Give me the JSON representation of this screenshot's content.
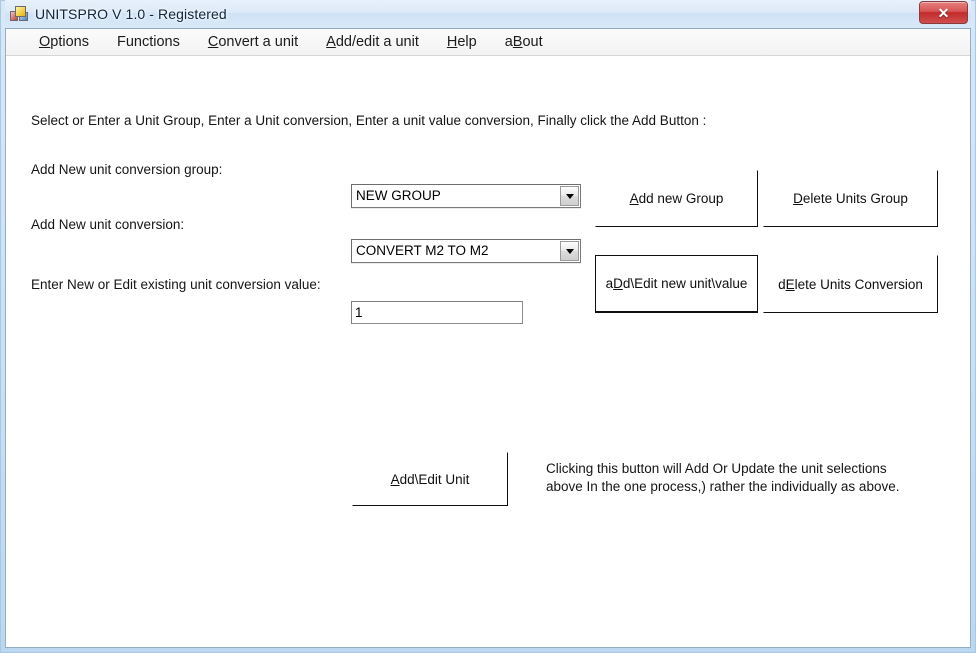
{
  "window": {
    "title": "UNITSPRO V 1.0 - Registered",
    "app_icon": "vb-form-icon",
    "close_label": "✕",
    "accent_color": "#c22a2a",
    "titlebar_color": "#dce9f8",
    "frame_color": "#bcd8f0"
  },
  "menubar": {
    "items": [
      {
        "pre": "",
        "acc": "O",
        "post": "ptions",
        "name": "menu-options"
      },
      {
        "pre": "Functions",
        "acc": "",
        "post": "",
        "name": "menu-functions"
      },
      {
        "pre": "",
        "acc": "C",
        "post": "onvert a unit",
        "name": "menu-convert-a-unit"
      },
      {
        "pre": "",
        "acc": "A",
        "post": "dd/edit a unit",
        "name": "menu-add-edit-a-unit"
      },
      {
        "pre": "",
        "acc": "H",
        "post": "elp",
        "name": "menu-help"
      },
      {
        "pre": "a",
        "acc": "B",
        "post": "out",
        "name": "menu-about"
      }
    ]
  },
  "main": {
    "instruction": "Select or Enter a Unit Group, Enter a Unit conversion, Enter a unit value conversion, Finally click the Add Button :",
    "labels": {
      "group": "Add New unit conversion group:",
      "conversion": "Add New unit conversion:",
      "value": "Enter New or Edit existing unit conversion value:"
    },
    "combo_group": {
      "value": "NEW GROUP",
      "options": [
        "NEW GROUP"
      ],
      "arrow_icon": "chevron-down-icon"
    },
    "combo_conversion": {
      "value": "CONVERT M2 TO M2",
      "options": [
        "CONVERT M2 TO M2"
      ],
      "arrow_icon": "chevron-down-icon"
    },
    "value_input": {
      "value": "1",
      "placeholder": ""
    },
    "buttons": {
      "add_group": {
        "pre": "",
        "acc": "A",
        "post": "dd new Group"
      },
      "delete_group": {
        "pre": "",
        "acc": "D",
        "post": "elete Units Group"
      },
      "add_conversion": {
        "pre": "a",
        "acc": "D",
        "post": "d\\Edit new unit\\value"
      },
      "delete_conversion": {
        "pre": "d",
        "acc": "E",
        "post": "lete Units Conversion"
      },
      "add_edit_unit": {
        "pre": "",
        "acc": "A",
        "post": "dd\\Edit Unit"
      }
    },
    "description_line1": "Clicking this button will Add Or Update the unit selections",
    "description_line2": "above In the one process,) rather the individually as above."
  }
}
